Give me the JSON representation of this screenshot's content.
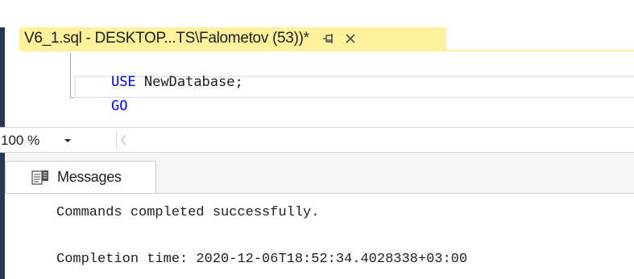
{
  "document_tab": {
    "title": "V6_1.sql - DESKTOP...TS\\Falometov (53))*",
    "pin_icon": "pin-icon",
    "close_icon": "close-icon"
  },
  "editor": {
    "lines": [
      {
        "keyword": "USE",
        "rest": " NewDatabase;"
      },
      {
        "keyword": "GO",
        "rest": ""
      }
    ]
  },
  "zoom": {
    "value": "100 %",
    "caret_icon": "chevron-down-icon",
    "scroll_icon": "chevron-left-icon"
  },
  "results": {
    "tab_label": "Messages",
    "tab_icon": "messages-icon",
    "messages": [
      "Commands completed successfully.",
      "Completion time: 2020-12-06T18:52:34.4028338+03:00"
    ]
  },
  "colors": {
    "tab_active": "#fff29d",
    "keyword": "#0000ff",
    "frame": "#293955"
  }
}
